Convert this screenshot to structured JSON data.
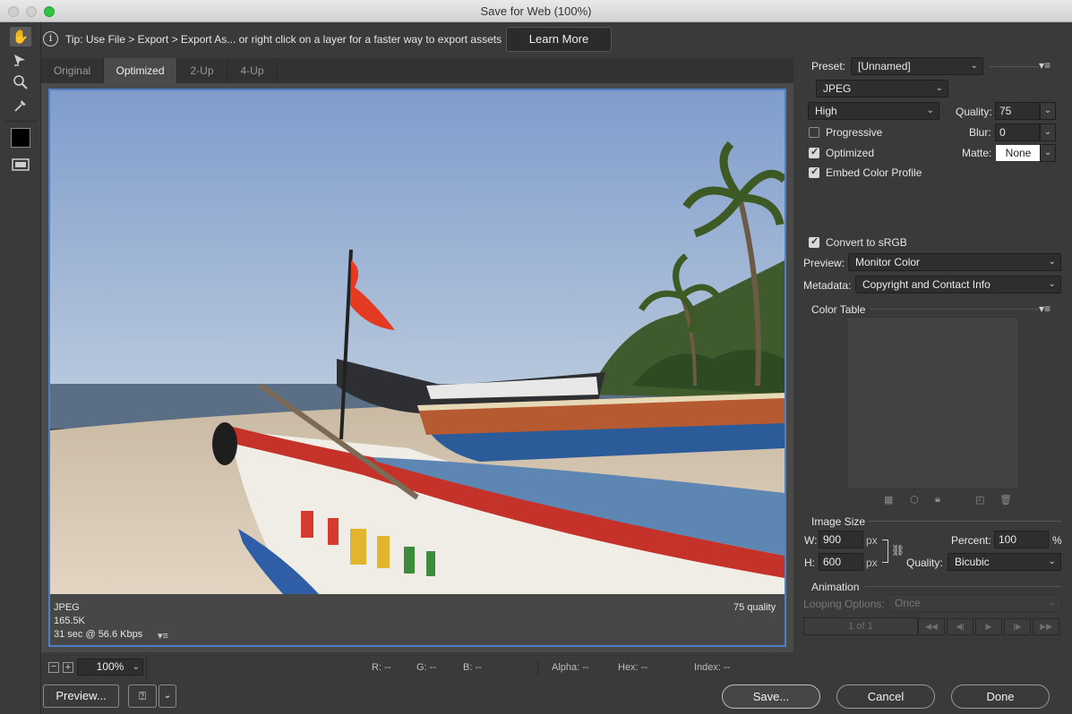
{
  "window": {
    "title": "Save for Web (100%)"
  },
  "tip": {
    "text": "Tip: Use File > Export > Export As...  or right click on a layer for a faster way to export assets",
    "button": "Learn More"
  },
  "tabs": [
    "Original",
    "Optimized",
    "2-Up",
    "4-Up"
  ],
  "preview": {
    "format": "JPEG",
    "size": "165.5K",
    "download": "31 sec @ 56.6 Kbps",
    "quality_note": "75 quality"
  },
  "statusbar": {
    "zoom": "100%",
    "r": "R: --",
    "g": "G: --",
    "b": "B: --",
    "alpha": "Alpha: --",
    "hex": "Hex: --",
    "index": "Index: --"
  },
  "settings": {
    "preset_label": "Preset:",
    "preset_value": "[Unnamed]",
    "format": "JPEG",
    "quality_level": "High",
    "quality_label": "Quality:",
    "quality_value": "75",
    "blur_label": "Blur:",
    "blur_value": "0",
    "matte_label": "Matte:",
    "matte_value": "None",
    "progressive": {
      "label": "Progressive",
      "checked": false
    },
    "optimized": {
      "label": "Optimized",
      "checked": true
    },
    "embed_profile": {
      "label": "Embed Color Profile",
      "checked": true
    },
    "convert_srgb": {
      "label": "Convert to sRGB",
      "checked": true
    },
    "preview_label": "Preview:",
    "preview_value": "Monitor Color",
    "metadata_label": "Metadata:",
    "metadata_value": "Copyright and Contact Info",
    "color_table_label": "Color Table"
  },
  "image_size": {
    "heading": "Image Size",
    "w_label": "W:",
    "w_value": "900",
    "h_label": "H:",
    "h_value": "600",
    "unit": "px",
    "percent_label": "Percent:",
    "percent_value": "100",
    "percent_unit": "%",
    "quality_label": "Quality:",
    "quality_value": "Bicubic"
  },
  "animation": {
    "heading": "Animation",
    "looping_label": "Looping Options:",
    "looping_value": "Once",
    "frame": "1 of 1"
  },
  "buttons": {
    "preview": "Preview...",
    "save": "Save...",
    "cancel": "Cancel",
    "done": "Done"
  },
  "icons": [
    "hand-tool-icon",
    "slice-select-icon",
    "zoom-tool-icon",
    "eyedropper-icon",
    "eyedropper-color-swatch",
    "toggle-slices-icon",
    "info-icon",
    "help-icon",
    "link-icon",
    "panel-menu-icon"
  ]
}
